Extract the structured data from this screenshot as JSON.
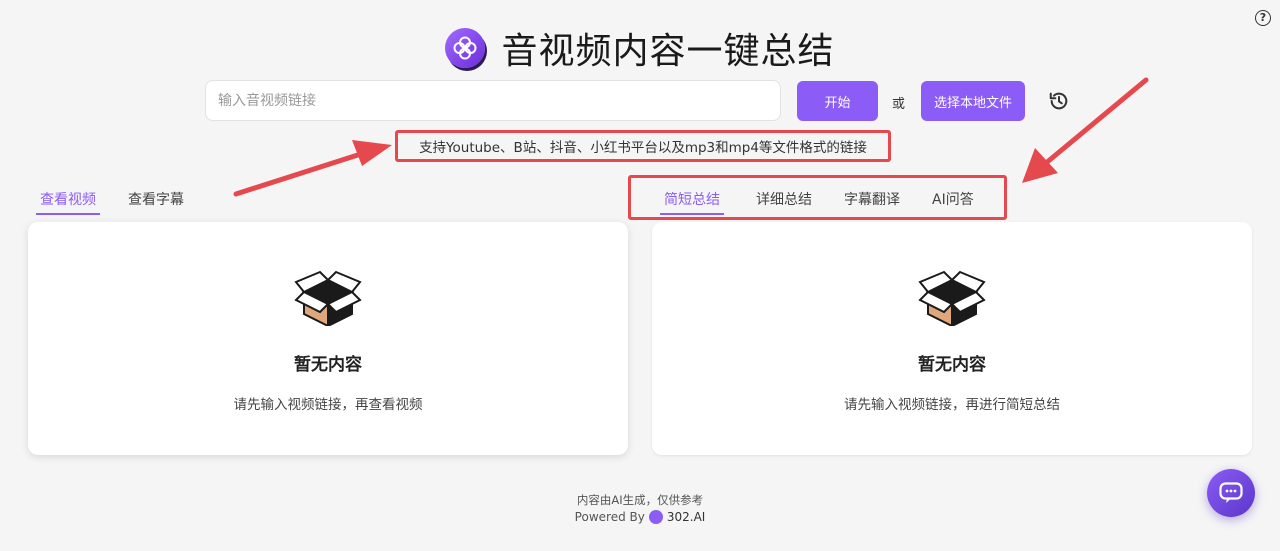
{
  "header": {
    "title": "音视频内容一键总结"
  },
  "search": {
    "placeholder": "输入音视频链接",
    "value": ""
  },
  "actions": {
    "start_label": "开始",
    "or_label": "或",
    "local_file_label": "选择本地文件"
  },
  "hint": {
    "text": "支持Youtube、B站、抖音、小红书平台以及mp3和mp4等文件格式的链接"
  },
  "left_tabs": [
    {
      "label": "查看视频",
      "active": true
    },
    {
      "label": "查看字幕",
      "active": false
    }
  ],
  "right_tabs": [
    {
      "label": "简短总结",
      "active": true
    },
    {
      "label": "详细总结",
      "active": false
    },
    {
      "label": "字幕翻译",
      "active": false
    },
    {
      "label": "AI问答",
      "active": false
    }
  ],
  "left_panel": {
    "title": "暂无内容",
    "desc": "请先输入视频链接，再查看视频"
  },
  "right_panel": {
    "title": "暂无内容",
    "desc": "请先输入视频链接，再进行简短总结"
  },
  "footer": {
    "disclaimer": "内容由AI生成，仅供参考",
    "powered_prefix": "Powered By",
    "brand": "302.AI"
  },
  "icons": {
    "help": "help-icon",
    "history": "history-icon",
    "empty": "empty-box-icon",
    "chat": "chat-icon"
  },
  "colors": {
    "accent": "#8b5cf6",
    "annotation_red": "#e5484d"
  }
}
